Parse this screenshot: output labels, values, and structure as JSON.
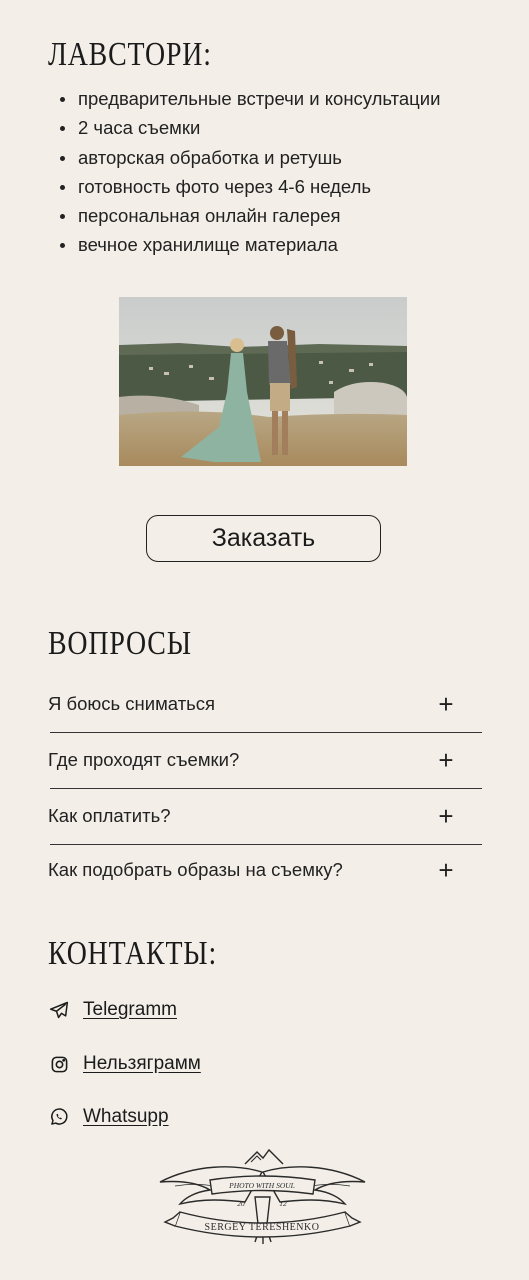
{
  "love_story": {
    "title": "ЛАВСТОРИ:",
    "features": [
      "предварительные встречи и консультации",
      "2 часа съемки",
      "авторская обработка и ретушь",
      "готовность фото через 4-6 недель",
      "персональная онлайн галерея",
      "вечное хранилище материала"
    ],
    "order_label": "Заказать"
  },
  "faq": {
    "title": "ВОПРОСЫ",
    "items": [
      "Я боюсь сниматься",
      "Где проходят съемки?",
      "Как оплатить?",
      "Как подобрать образы на съемку?"
    ],
    "expand_icon": "plus-icon"
  },
  "contacts": {
    "title": "КОНТАКТЫ:",
    "links": [
      {
        "label": "Telegramm",
        "icon": "telegram-icon"
      },
      {
        "label": "Нельзяграмм",
        "icon": "instagram-icon"
      },
      {
        "label": "Whatsupp",
        "icon": "whatsapp-icon"
      }
    ]
  },
  "logo": {
    "line1": "PHOTO WITH SOUL",
    "year_left": "20",
    "year_right": "12",
    "name": "SERGEY TERESHENKO"
  },
  "colors": {
    "background": "#f3efe8",
    "text": "#1b1b1b"
  }
}
